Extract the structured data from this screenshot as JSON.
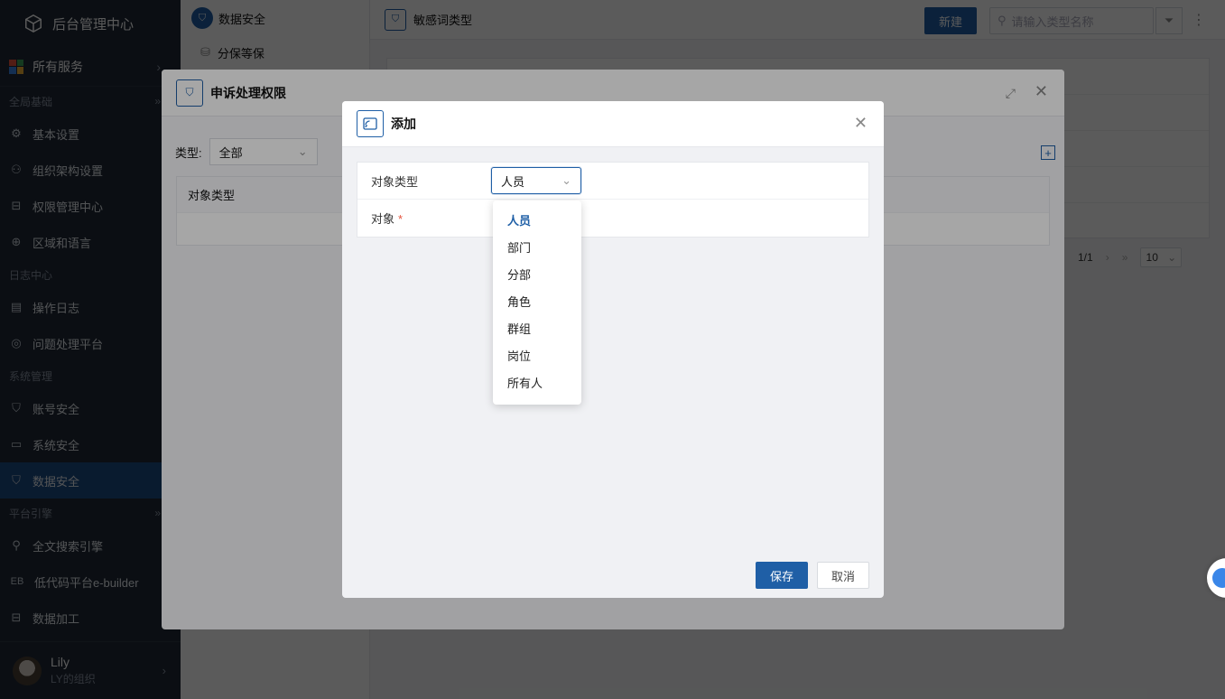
{
  "sidebar": {
    "title": "后台管理中心",
    "all_services": "所有服务",
    "sections": [
      {
        "label": "全局基础",
        "items": [
          "基本设置",
          "组织架构设置",
          "权限管理中心",
          "区域和语言"
        ]
      },
      {
        "label": "日志中心",
        "items": [
          "操作日志",
          "问题处理平台"
        ]
      },
      {
        "label": "系统管理",
        "items": [
          "账号安全",
          "系统安全",
          "数据安全"
        ]
      },
      {
        "label": "平台引擎",
        "items": [
          "全文搜索引擎",
          "低代码平台e-builder",
          "数据加工"
        ]
      }
    ],
    "eb_badge": "EB",
    "user": {
      "name": "Lily",
      "org": "LY的组织"
    }
  },
  "panel2": {
    "title": "数据安全",
    "items": [
      "分保等保"
    ]
  },
  "main": {
    "title": "敏感词类型",
    "new_button": "新建",
    "search_placeholder": "请输入类型名称",
    "pager": {
      "page": "1/1",
      "page_size": "10"
    }
  },
  "modal1": {
    "title": "申诉处理权限",
    "filter_label": "类型:",
    "filter_value": "全部",
    "table_header": "对象类型"
  },
  "modal2": {
    "title": "添加",
    "fields": {
      "object_type_label": "对象类型",
      "object_type_value": "人员",
      "object_label": "对象",
      "required_mark": "*"
    },
    "dropdown_options": [
      "人员",
      "部门",
      "分部",
      "角色",
      "群组",
      "岗位",
      "所有人"
    ],
    "save_button": "保存",
    "cancel_button": "取消"
  },
  "colors": {
    "primary": "#1f5fa6",
    "sidebar_bg": "#1f2937",
    "active_item": "#1d4e86",
    "required": "#e5533d"
  }
}
